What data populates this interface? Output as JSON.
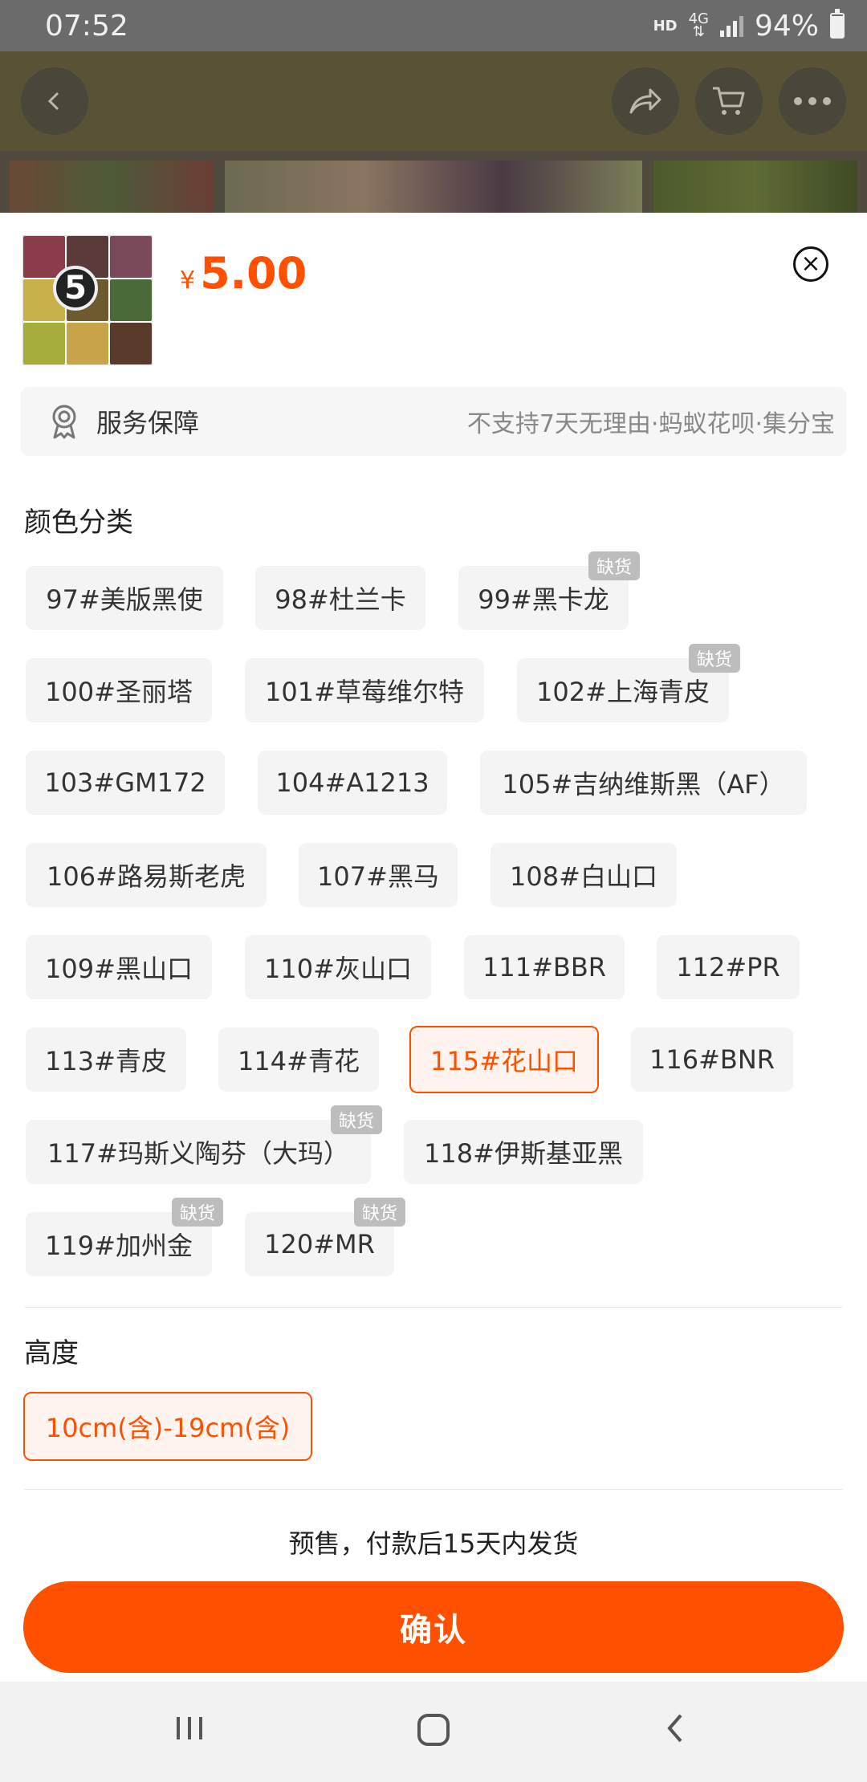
{
  "status_bar": {
    "time": "07:52",
    "hd": "HD",
    "network": "4G",
    "battery_percent": "94%",
    "battery_level": 0.94
  },
  "header": {
    "back_icon": "chevron-left-icon",
    "share_icon": "share-icon",
    "cart_icon": "cart-icon",
    "more_icon": "more-icon"
  },
  "product": {
    "price_symbol": "¥",
    "price": "5.00",
    "image_badge": "5"
  },
  "service": {
    "label": "服务保障",
    "detail": "不支持7天无理由·蚂蚁花呗·集分宝"
  },
  "color_section": {
    "title": "颜色分类",
    "options": [
      {
        "label": "97#美版黑使",
        "out_of_stock": false,
        "selected": false
      },
      {
        "label": "98#杜兰卡",
        "out_of_stock": false,
        "selected": false
      },
      {
        "label": "99#黑卡龙",
        "out_of_stock": true,
        "selected": false
      },
      {
        "label": "100#圣丽塔",
        "out_of_stock": false,
        "selected": false
      },
      {
        "label": "101#草莓维尔特",
        "out_of_stock": false,
        "selected": false
      },
      {
        "label": "102#上海青皮",
        "out_of_stock": true,
        "selected": false
      },
      {
        "label": "103#GM172",
        "out_of_stock": false,
        "selected": false
      },
      {
        "label": "104#A1213",
        "out_of_stock": false,
        "selected": false
      },
      {
        "label": "105#吉纳维斯黑（AF）",
        "out_of_stock": false,
        "selected": false
      },
      {
        "label": "106#路易斯老虎",
        "out_of_stock": false,
        "selected": false
      },
      {
        "label": "107#黑马",
        "out_of_stock": false,
        "selected": false
      },
      {
        "label": "108#白山口",
        "out_of_stock": false,
        "selected": false
      },
      {
        "label": "109#黑山口",
        "out_of_stock": false,
        "selected": false
      },
      {
        "label": "110#灰山口",
        "out_of_stock": false,
        "selected": false
      },
      {
        "label": "111#BBR",
        "out_of_stock": false,
        "selected": false
      },
      {
        "label": "112#PR",
        "out_of_stock": false,
        "selected": false
      },
      {
        "label": "113#青皮",
        "out_of_stock": false,
        "selected": false
      },
      {
        "label": "114#青花",
        "out_of_stock": false,
        "selected": false
      },
      {
        "label": "115#花山口",
        "out_of_stock": false,
        "selected": true
      },
      {
        "label": "116#BNR",
        "out_of_stock": false,
        "selected": false
      },
      {
        "label": "117#玛斯义陶芬（大玛）",
        "out_of_stock": true,
        "selected": false
      },
      {
        "label": "118#伊斯基亚黑",
        "out_of_stock": false,
        "selected": false
      },
      {
        "label": "119#加州金",
        "out_of_stock": true,
        "selected": false
      },
      {
        "label": "120#MR",
        "out_of_stock": true,
        "selected": false
      }
    ],
    "out_of_stock_label": "缺货"
  },
  "height_section": {
    "title": "高度",
    "options": [
      {
        "label": "10cm(含)-19cm(含)",
        "selected": true
      }
    ]
  },
  "shipping_note": "预售，付款后15天内发货",
  "confirm_label": "确认",
  "nav": {
    "recents_icon": "recents-icon",
    "home_icon": "home-icon",
    "back_icon": "back-icon"
  },
  "colors": {
    "accent": "#ff5000",
    "badge_gray": "#bdbdbd",
    "chip_bg": "#f4f4f4"
  }
}
